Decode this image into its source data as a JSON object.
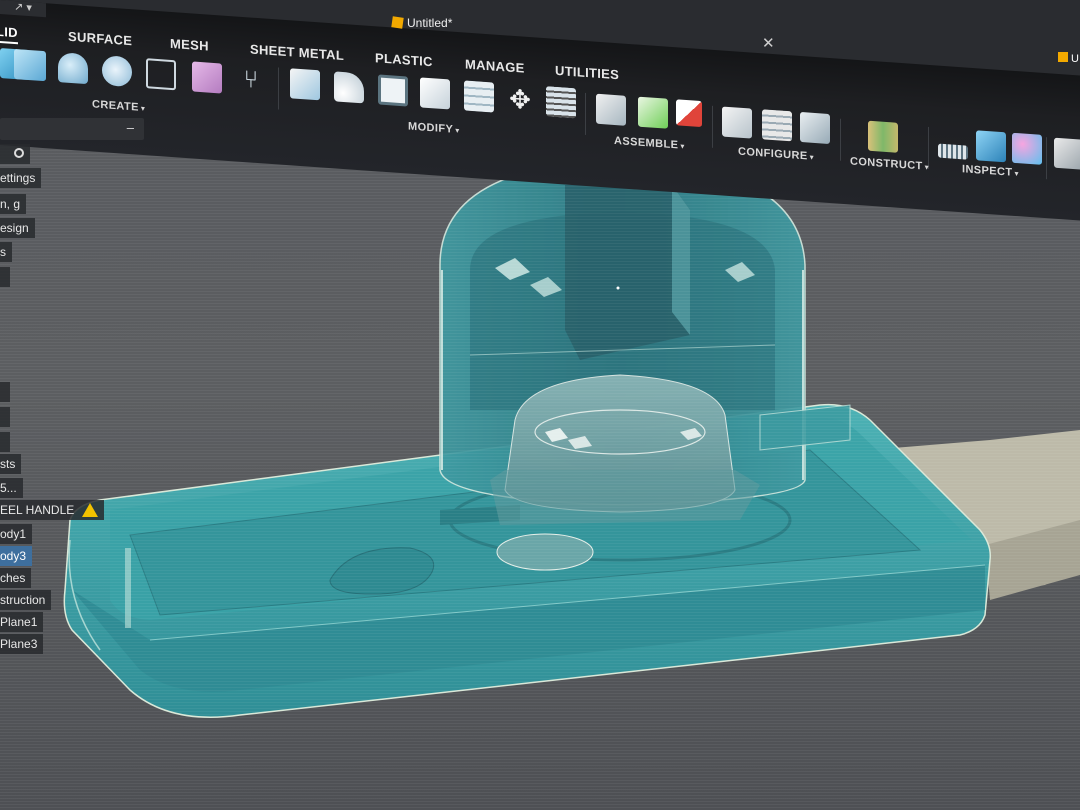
{
  "app": {
    "document_title": "Untitled*",
    "second_tab_label": "U",
    "close_symbol": "✕"
  },
  "ribbon": {
    "tabs": [
      "LID",
      "SURFACE",
      "MESH",
      "SHEET METAL",
      "PLASTIC",
      "MANAGE",
      "UTILITIES"
    ],
    "groups": [
      "CREATE",
      "MODIFY",
      "ASSEMBLE",
      "CONFIGURE",
      "CONSTRUCT",
      "INSPECT"
    ],
    "group_caret": "▾"
  },
  "browser": {
    "collapse_symbol": "–",
    "items": [
      "ettings",
      "n, g",
      "esign",
      "s",
      "sts",
      "5...",
      "EEL HANDLE",
      "ody1",
      "ody3",
      "ches",
      "struction",
      "Plane1",
      "Plane3"
    ],
    "selected_index": 8
  },
  "colors": {
    "ribbon_bg": "#1e1f22",
    "viewport_bg": "#5a5c60",
    "body_teal": "#3a9ea3",
    "body_teal_dark": "#1f6f78",
    "selection_blue": "#3e6f9e",
    "warning_yellow": "#f2c200",
    "doc_icon": "#f2a900",
    "gray_part": "#b9b6a8"
  }
}
